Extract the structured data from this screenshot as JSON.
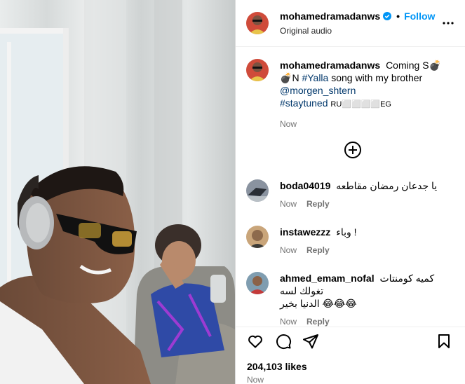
{
  "header": {
    "username": "mohamedramadanws",
    "separator": "•",
    "follow_label": "Follow",
    "audio": "Original audio"
  },
  "caption": {
    "username": "mohamedramadanws",
    "text_1": "Coming S",
    "emoji_1": "💣",
    "text_2": "N",
    "hashtag_1": "#Yalla",
    "text_3": "song with my brother",
    "mention": "@morgen_shtern",
    "hashtag_2": "#staytuned",
    "text_4": "RU⬜⬜⬜⬜EG",
    "time": "Now"
  },
  "comments": [
    {
      "username": "boda04019",
      "text": "يا جدعان رمضان مقاطعه",
      "time": "Now",
      "reply": "Reply"
    },
    {
      "username": "instawezzz",
      "text": "وباء !",
      "time": "Now",
      "reply": "Reply"
    },
    {
      "username": "ahmed_emam_nofal",
      "text": "كميه كومنتات تغولك لسه",
      "text_2": "الدنيا بخير 😂😂😂",
      "time": "Now",
      "reply": "Reply"
    }
  ],
  "actions": {
    "likes": "204,103 likes",
    "time": "Now"
  },
  "colors": {
    "accent": "#0095f6",
    "link": "#00376b",
    "muted": "#737373",
    "border": "#dbdbdb"
  }
}
